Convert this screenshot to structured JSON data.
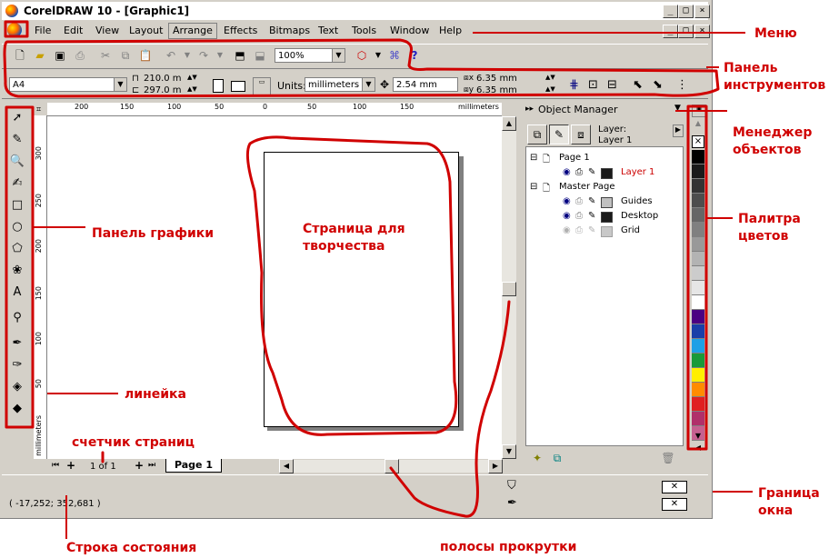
{
  "window": {
    "title": "CorelDRAW 10 - [Graphic1]"
  },
  "title_buttons": {
    "minimize": "_",
    "restore": "□",
    "close": "×"
  },
  "menubar": {
    "items": [
      "File",
      "Edit",
      "View",
      "Layout",
      "Arrange",
      "Effects",
      "Bitmaps",
      "Text",
      "Tools",
      "Window",
      "Help"
    ]
  },
  "toolbar": {
    "zoom": "100%"
  },
  "propbar": {
    "paper": "A4",
    "width": "210.0 m",
    "height": "297.0 m",
    "units_label": "Units:",
    "units": "millimeters",
    "nudge": "2.54 mm",
    "dup_x": "6.35 mm",
    "dup_y": "6.35 mm"
  },
  "ruler": {
    "h_ticks": [
      "200",
      "150",
      "100",
      "50",
      "0",
      "50",
      "100",
      "150",
      "millimeters"
    ],
    "v_ticks": [
      "300",
      "250",
      "200",
      "150",
      "100",
      "50"
    ],
    "v_unit": "millimeters"
  },
  "page_nav": {
    "counter": "1 of 1",
    "tab": "Page 1"
  },
  "object_manager": {
    "header": "Object Manager",
    "layer_label": "Layer:",
    "layer_name": "Layer 1",
    "tree": [
      {
        "label": "Page 1"
      },
      {
        "label": "Layer 1",
        "color": "#cc0000"
      },
      {
        "label": "Master Page"
      },
      {
        "label": "Guides"
      },
      {
        "label": "Desktop"
      },
      {
        "label": "Grid"
      }
    ]
  },
  "palette": [
    "#000000",
    "#1a1a1a",
    "#333333",
    "#4d4d4d",
    "#666666",
    "#808080",
    "#999999",
    "#b3b3b3",
    "#cccccc",
    "#e6e6e6",
    "#ffffff",
    "#4b0082",
    "#1a3fa8",
    "#1ea0e6",
    "#1a9a3a",
    "#ffef00",
    "#ff8c00",
    "#e02020",
    "#b0306a",
    "#c66090"
  ],
  "status": {
    "coords": "( -17,252; 352,681 )"
  },
  "annotations": {
    "menu": "Меню",
    "toolbars": "Панель инструментов",
    "object_manager": "Менеджер объектов",
    "palette": "Палитра цветов",
    "toolbox": "Панель графики",
    "page": "Страница для творчества",
    "ruler": "линейка",
    "page_counter": "счетчик страниц",
    "window_border": "Граница окна",
    "statusbar": "Строка состояния",
    "scrollbars": "полосы прокрутки"
  },
  "colors": {
    "annotation": "#d00000",
    "chrome": "#d4d0c8"
  }
}
